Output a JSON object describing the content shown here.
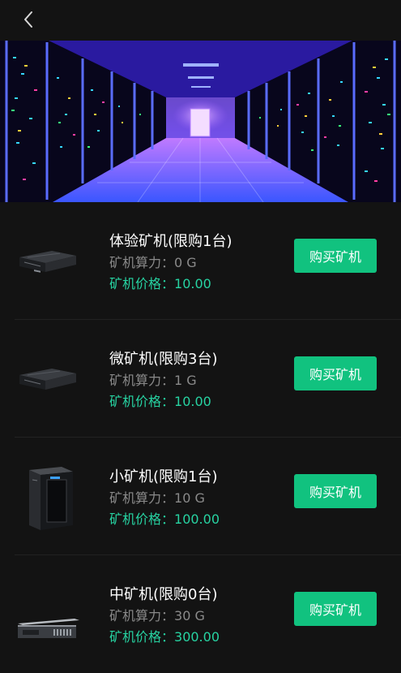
{
  "header": {
    "back_icon": "chevron-left-icon"
  },
  "banner": {
    "image": "server-room-image",
    "accent_colors": [
      "#2a0fd8",
      "#9b3dff",
      "#00c6ff"
    ]
  },
  "colors": {
    "background": "#131313",
    "buy_button": "#11c27f",
    "price_text": "#27d3a2",
    "power_text": "#8a8a8a"
  },
  "items": [
    {
      "name": "体验矿机(限购1台)",
      "power_label": "矿机算力：",
      "power_value": "0 G",
      "price_label": "矿机价格：",
      "price_value": "10.00",
      "button_label": "购买矿机",
      "image": "server-rack-icon"
    },
    {
      "name": "微矿机(限购3台)",
      "power_label": "矿机算力：",
      "power_value": "1 G",
      "price_label": "矿机价格：",
      "price_value": "10.00",
      "button_label": "购买矿机",
      "image": "server-rack-icon"
    },
    {
      "name": "小矿机(限购1台)",
      "power_label": "矿机算力：",
      "power_value": "10 G",
      "price_label": "矿机价格：",
      "price_value": "100.00",
      "button_label": "购买矿机",
      "image": "pc-tower-icon"
    },
    {
      "name": "中矿机(限购0台)",
      "power_label": "矿机算力：",
      "power_value": "30 G",
      "price_label": "矿机价格：",
      "price_value": "300.00",
      "button_label": "购买矿机",
      "image": "rack-server-icon"
    }
  ]
}
